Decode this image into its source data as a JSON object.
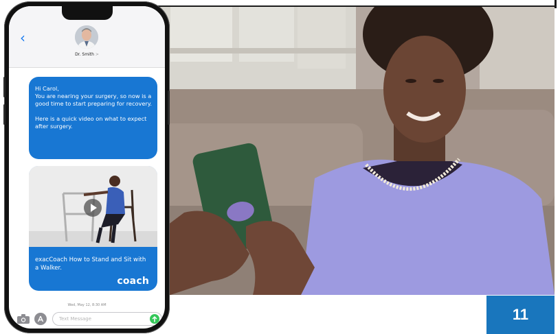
{
  "phone": {
    "contact": {
      "name": "Dr. Smith",
      "chevron": ">"
    },
    "back_label": "‹",
    "message": {
      "line1": "Hi Carol,",
      "line2": "You are nearing your surgery, so now is a good time to start preparing for recovery.",
      "line3": "Here is a quick video on what to expect after surgery."
    },
    "video": {
      "caption": "exacCoach How to Stand and Sit with a Walker.",
      "brand": "coach"
    },
    "timestamp": "Wed, May 12, 8:30 AM",
    "input": {
      "placeholder": "Text Message"
    },
    "icons": [
      "back-chevron-icon",
      "avatar",
      "play-icon",
      "camera-icon",
      "app-store-icon",
      "send-arrow-icon"
    ]
  },
  "page_badge": {
    "number": "11"
  },
  "colors": {
    "bubble": "#1877d3",
    "badge": "#1976bd",
    "send": "#34c759",
    "shirt": "#9d9ae0",
    "phone_case": "#2e5a3c"
  }
}
